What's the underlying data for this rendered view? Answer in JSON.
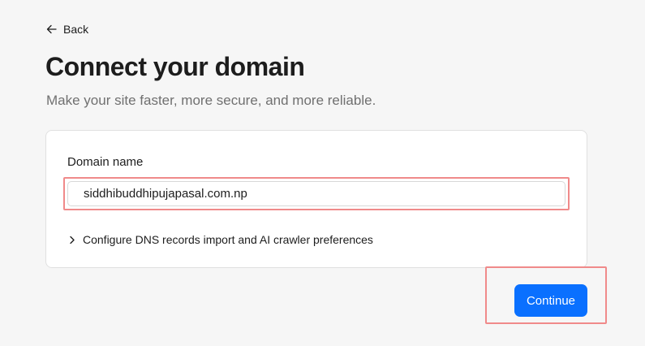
{
  "nav": {
    "back_label": "Back",
    "back_icon": "arrow-left-icon"
  },
  "header": {
    "title": "Connect your domain",
    "subtitle": "Make your site faster, more secure, and more reliable."
  },
  "form": {
    "domain_label": "Domain name",
    "domain_value": "siddhibuddhipujapasal.com.np",
    "disclosure_icon": "chevron-right-icon",
    "disclosure_label": "Configure DNS records import and AI crawler preferences"
  },
  "actions": {
    "continue_label": "Continue"
  },
  "colors": {
    "accent": "#0a70ff",
    "highlight": "#f08a8a",
    "background": "#f6f6f6",
    "card": "#ffffff",
    "muted_text": "#707070"
  }
}
